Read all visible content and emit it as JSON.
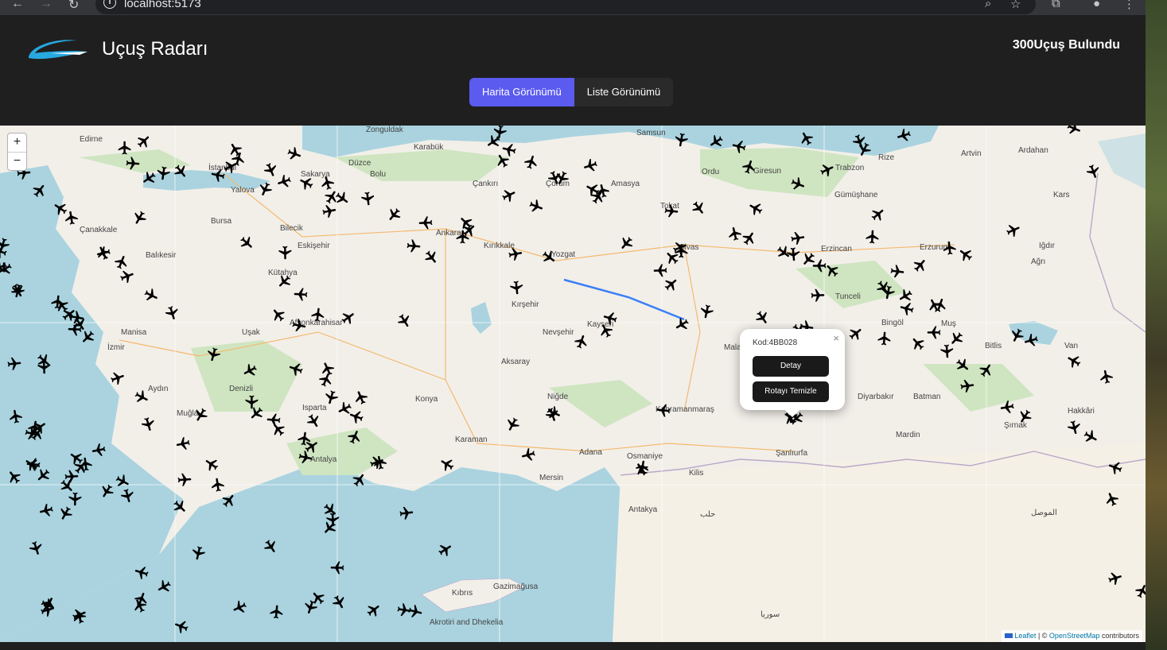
{
  "browser": {
    "url": "localhost:5173",
    "icons": [
      "back-icon",
      "forward-icon",
      "reload-icon",
      "info-icon",
      "zoom-icon",
      "star-icon",
      "extensions-icon",
      "profile-icon",
      "menu-icon"
    ]
  },
  "header": {
    "title": "Uçuş Radarı",
    "flight_count": "300Uçuş Bulundu",
    "logo_color": "#29a8e0"
  },
  "tabs": [
    {
      "label": "Harita Görünümü",
      "active": true
    },
    {
      "label": "Liste Görünümü",
      "active": false
    }
  ],
  "colors": {
    "accent": "#5b5bf0",
    "header_bg": "#1f1f1f",
    "route": "#3b7ff5"
  },
  "map": {
    "zoom_in": "+",
    "zoom_out": "−",
    "cities": [
      {
        "name": "İstanbul"
      },
      {
        "name": "Bursa"
      },
      {
        "name": "Balıkesir"
      },
      {
        "name": "Eskişehir"
      },
      {
        "name": "Kütahya"
      },
      {
        "name": "Ankara"
      },
      {
        "name": "Afyonkarahisar"
      },
      {
        "name": "Manisa"
      },
      {
        "name": "İzmir"
      },
      {
        "name": "Aydın"
      },
      {
        "name": "Muğla"
      },
      {
        "name": "Isparta"
      },
      {
        "name": "Antalya"
      },
      {
        "name": "Konya"
      },
      {
        "name": "Karaman"
      },
      {
        "name": "Aksaray"
      },
      {
        "name": "Nevşehir"
      },
      {
        "name": "Kırşehir"
      },
      {
        "name": "Kayseri"
      },
      {
        "name": "Yozgat"
      },
      {
        "name": "Sivas"
      },
      {
        "name": "Ordu"
      },
      {
        "name": "Giresun"
      },
      {
        "name": "Trabzon"
      },
      {
        "name": "Rize"
      },
      {
        "name": "Gümüşhane"
      },
      {
        "name": "Erzincan"
      },
      {
        "name": "Erzurum"
      },
      {
        "name": "Ağrı"
      },
      {
        "name": "Bingöl"
      },
      {
        "name": "Muş"
      },
      {
        "name": "Diyarbakır"
      },
      {
        "name": "Batman"
      },
      {
        "name": "Şanlıurfa"
      },
      {
        "name": "Kahramanmaraş"
      },
      {
        "name": "Adana"
      },
      {
        "name": "Osmaniye"
      },
      {
        "name": "Mersin"
      },
      {
        "name": "Antakya"
      },
      {
        "name": "Kilis"
      },
      {
        "name": "Hakkâri"
      },
      {
        "name": "Mardin"
      },
      {
        "name": "Kıbrıs"
      },
      {
        "name": "Gazimağusa"
      },
      {
        "name": "Akrotiri and Dhekelia"
      },
      {
        "name": "Samsun"
      },
      {
        "name": "Karabük"
      },
      {
        "name": "Düzce"
      },
      {
        "name": "Bolu"
      },
      {
        "name": "Çankırı"
      },
      {
        "name": "Çorum"
      },
      {
        "name": "Amasya"
      },
      {
        "name": "Tokat"
      },
      {
        "name": "Malatya"
      },
      {
        "name": "Niğde"
      },
      {
        "name": "Yalova"
      },
      {
        "name": "Sakarya"
      },
      {
        "name": "Bilecik"
      },
      {
        "name": "Uşak"
      },
      {
        "name": "Denizli"
      },
      {
        "name": "Kırıkkale"
      },
      {
        "name": "Tunceli"
      },
      {
        "name": "Bitlis"
      },
      {
        "name": "Van"
      },
      {
        "name": "Artvin"
      },
      {
        "name": "Ardahan"
      },
      {
        "name": "Kars"
      },
      {
        "name": "Iğdır"
      },
      {
        "name": "Edirne"
      },
      {
        "name": "Zonguldak"
      },
      {
        "name": "Çanakkale"
      },
      {
        "name": "Şırnak"
      },
      {
        "name": "سوريا"
      },
      {
        "name": "حلب"
      },
      {
        "name": "الموصل"
      }
    ],
    "popup": {
      "code": "Kod:4BB028",
      "detail_button": "Detay",
      "clear_route_button": "Rotayı Temizle",
      "close": "×"
    },
    "attribution": {
      "leaflet": "Leaflet",
      "separator": " | © ",
      "osm": "OpenStreetMap",
      "suffix": " contributors"
    }
  }
}
